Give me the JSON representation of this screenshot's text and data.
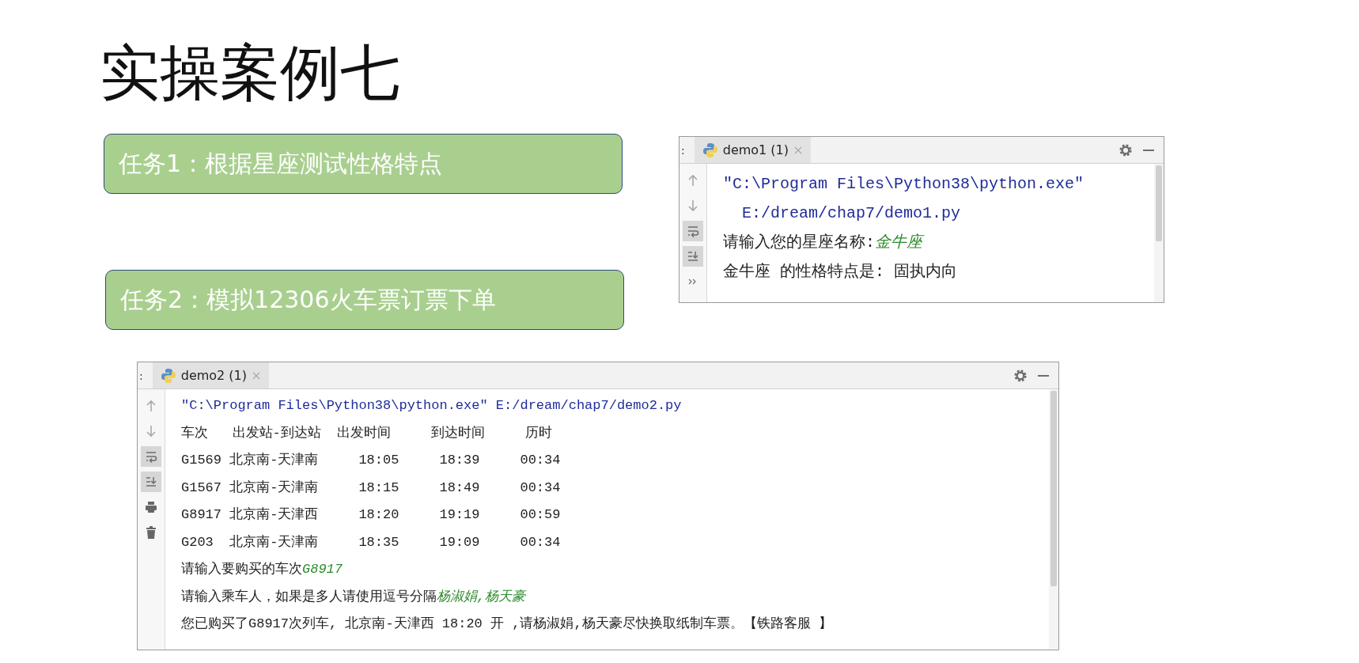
{
  "slide": {
    "title": "实操案例七"
  },
  "tasks": [
    {
      "label": "任务1：根据星座测试性格特点"
    },
    {
      "label": "任务2：模拟12306火车票订票下单"
    }
  ],
  "consoles": [
    {
      "edge_label": ":",
      "tab": {
        "title": "demo1 (1)",
        "selected": true
      },
      "gutter": [
        {
          "kind": "up",
          "selected": false
        },
        {
          "kind": "down",
          "selected": false
        },
        {
          "kind": "wrap",
          "selected": true
        },
        {
          "kind": "scroll-end",
          "selected": true
        },
        {
          "kind": "more",
          "selected": false
        }
      ],
      "lines": [
        [
          {
            "kind": "path",
            "text": "\"C:\\Program Files\\Python38\\python.exe\""
          }
        ],
        [
          {
            "kind": "path",
            "text": "  E:/dream/chap7/demo1.py"
          }
        ],
        [
          {
            "kind": "plain",
            "text": "请输入您的星座名称:"
          },
          {
            "kind": "input",
            "text": "金牛座"
          }
        ],
        [
          {
            "kind": "plain",
            "text": "金牛座 的性格特点是: 固执内向"
          }
        ]
      ]
    },
    {
      "edge_label": ":",
      "tab": {
        "title": "demo2 (1)",
        "selected": true
      },
      "gutter": [
        {
          "kind": "up",
          "selected": false
        },
        {
          "kind": "down",
          "selected": false
        },
        {
          "kind": "wrap",
          "selected": true
        },
        {
          "kind": "scroll-end",
          "selected": true
        },
        {
          "kind": "print",
          "selected": false
        },
        {
          "kind": "trash",
          "selected": false
        }
      ],
      "lines": [
        [
          {
            "kind": "path",
            "text": "\"C:\\Program Files\\Python38\\python.exe\" E:/dream/chap7/demo2.py"
          }
        ],
        [
          {
            "kind": "plain",
            "text": "车次   出发站-到达站  出发时间     到达时间     历时"
          }
        ],
        [
          {
            "kind": "plain",
            "text": "G1569 北京南-天津南     18:05     18:39     00:34"
          }
        ],
        [
          {
            "kind": "plain",
            "text": "G1567 北京南-天津南     18:15     18:49     00:34"
          }
        ],
        [
          {
            "kind": "plain",
            "text": "G8917 北京南-天津西     18:20     19:19     00:59"
          }
        ],
        [
          {
            "kind": "plain",
            "text": "G203  北京南-天津南     18:35     19:09     00:34"
          }
        ],
        [
          {
            "kind": "plain",
            "text": "请输入要购买的车次"
          },
          {
            "kind": "input",
            "text": "G8917"
          }
        ],
        [
          {
            "kind": "plain",
            "text": "请输入乘车人，如果是多人请使用逗号分隔"
          },
          {
            "kind": "input",
            "text": "杨淑娟,杨天豪"
          }
        ],
        [
          {
            "kind": "plain",
            "text": "您已购买了G8917次列车, 北京南-天津西 18:20 开 ,请杨淑娟,杨天豪尽快换取纸制车票。【铁路客服 】"
          }
        ]
      ]
    }
  ]
}
